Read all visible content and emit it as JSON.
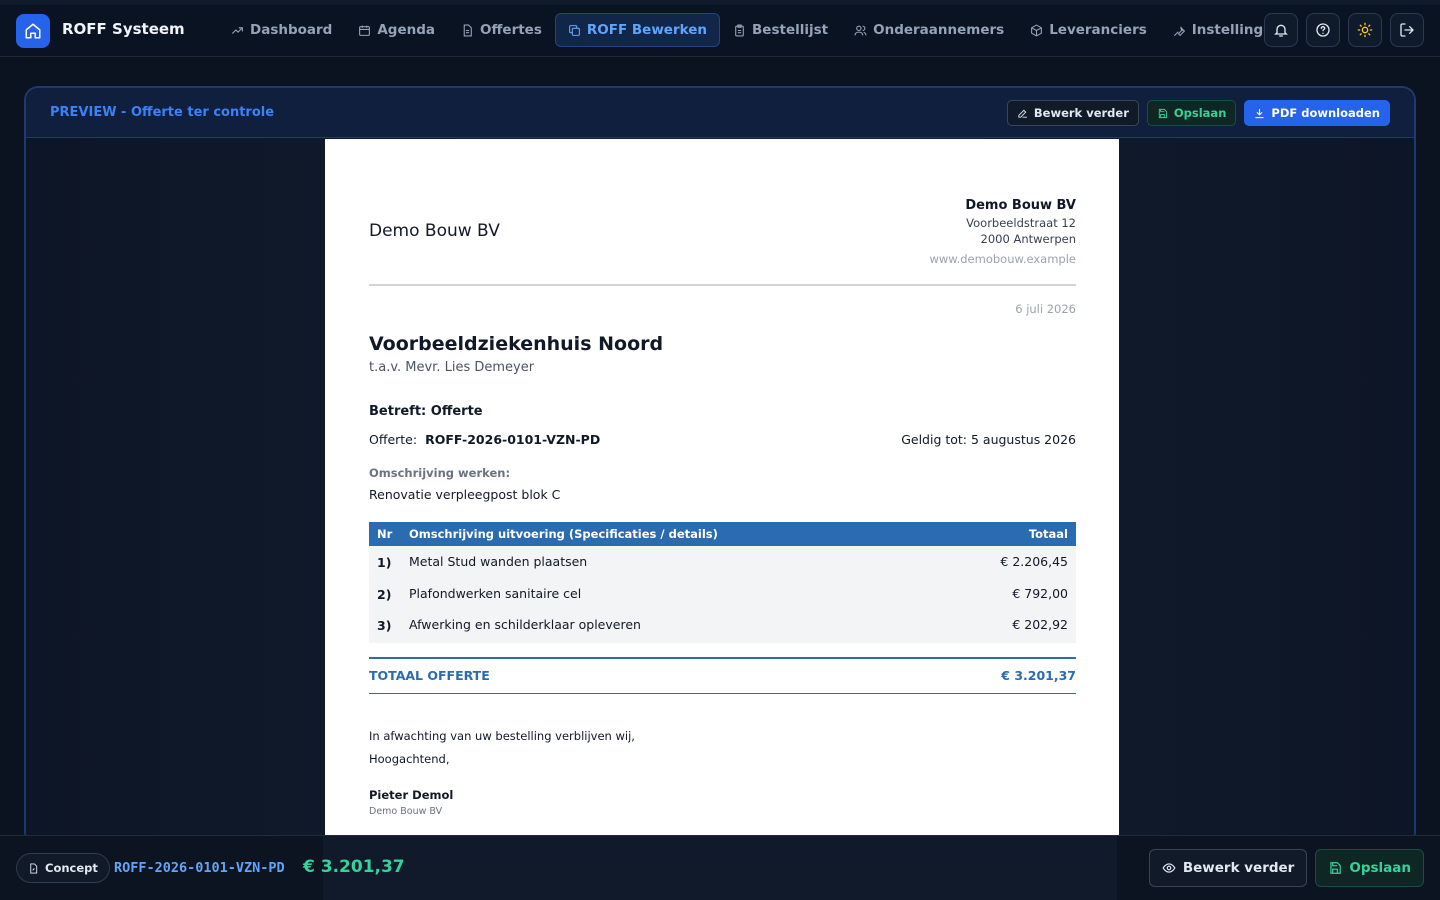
{
  "app": {
    "title": "ROFF Systeem"
  },
  "nav": [
    {
      "label": "Dashboard",
      "icon": "trending-up-icon"
    },
    {
      "label": "Agenda",
      "icon": "calendar-icon"
    },
    {
      "label": "Offertes",
      "icon": "file-icon"
    },
    {
      "label": "ROFF Bewerken",
      "icon": "copy-icon",
      "active": true
    },
    {
      "label": "Bestellijst",
      "icon": "clipboard-icon"
    },
    {
      "label": "Onderaannemers",
      "icon": "users-icon"
    },
    {
      "label": "Leveranciers",
      "icon": "package-icon"
    },
    {
      "label": "Instellingen",
      "icon": "wrench-icon"
    }
  ],
  "panel": {
    "title": "PREVIEW - Offerte ter controle",
    "edit_label": "Bewerk verder",
    "save_label": "Opslaan",
    "pdf_label": "PDF downloaden"
  },
  "doc": {
    "company_name": "Demo Bouw BV",
    "company_addr_name": "Demo Bouw BV",
    "company_street": "Voorbeeldstraat 12",
    "company_city": "2000 Antwerpen",
    "company_web": "www.demobouw.example",
    "date": "6 juli 2026",
    "client": "Voorbeeldziekenhuis Noord",
    "attn": "t.a.v. Mevr. Lies Demeyer",
    "subject": "Betreft: Offerte",
    "offer_label": "Offerte:",
    "offer_number": "ROFF-2026-0101-VZN-PD",
    "valid_until": "Geldig tot: 5 augustus 2026",
    "desc_label": "Omschrijving werken:",
    "desc_value": "Renovatie verpleegpost blok C",
    "table": {
      "headers": [
        "Nr",
        "Omschrijving uitvoering (Specificaties / details)",
        "Totaal"
      ],
      "rows": [
        {
          "nr": "1)",
          "desc": "Metal Stud wanden plaatsen",
          "total": "€ 2.206,45"
        },
        {
          "nr": "2)",
          "desc": "Plafondwerken sanitaire cel",
          "total": "€ 792,00"
        },
        {
          "nr": "3)",
          "desc": "Afwerking en schilderklaar opleveren",
          "total": "€ 202,92"
        }
      ]
    },
    "total_label": "TOTAAL OFFERTE",
    "total_value": "€ 3.201,37",
    "closing": "In afwachting van uw bestelling verblijven wij,",
    "greeting": "Hoogachtend,",
    "signer": "Pieter Demol",
    "signer_company": "Demo Bouw BV"
  },
  "bottom": {
    "status": "Concept",
    "reference": "ROFF-2026-0101-VZN-PD",
    "amount": "€ 3.201,37",
    "edit_label": "Bewerk verder",
    "save_label": "Opslaan"
  },
  "colors": {
    "accent": "#2563eb",
    "accent_text": "#60a5fa",
    "success": "#34d399",
    "table_header": "#2b6cb0"
  }
}
